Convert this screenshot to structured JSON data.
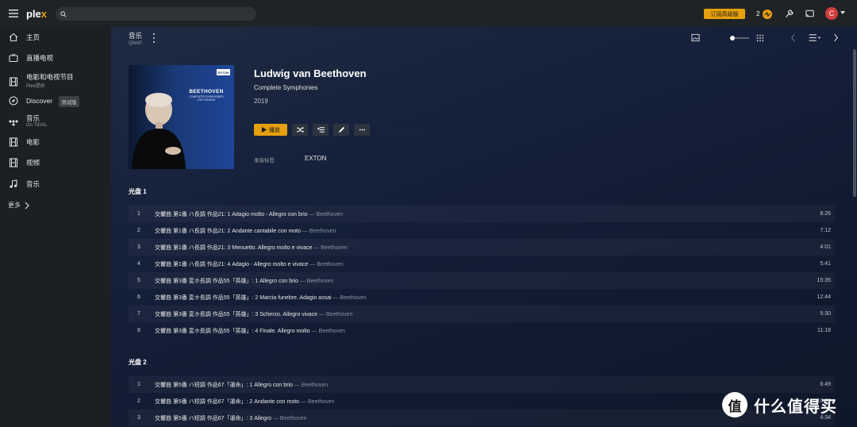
{
  "topbar": {
    "logo_main": "ple",
    "logo_x": "x",
    "search_placeholder": "",
    "subscribe_label": "订阅高级版",
    "activity_count": "2",
    "avatar_initial": "C"
  },
  "sidebar": {
    "items": [
      {
        "label": "主页",
        "sub": "",
        "icon": "home-icon"
      },
      {
        "label": "直播电视",
        "sub": "",
        "icon": "tv-icon"
      },
      {
        "label": "电影和电视节目",
        "sub": "Plex提供",
        "icon": "film-icon"
      },
      {
        "label": "Discover",
        "sub": "",
        "icon": "compass-icon"
      },
      {
        "label": "音乐",
        "sub": "On TIDAL",
        "icon": "tidal-icon"
      },
      {
        "label": "电影",
        "sub": "",
        "icon": "film-icon"
      },
      {
        "label": "视频",
        "sub": "",
        "icon": "film-icon"
      },
      {
        "label": "音乐",
        "sub": "",
        "icon": "music-note-icon"
      }
    ],
    "beta_badge": "测试版",
    "more_label": "更多"
  },
  "header": {
    "title": "音乐",
    "server": "QNAP"
  },
  "album": {
    "cover_title": "BEETHOVEN",
    "cover_sub1": "COMPLETE SYMPHONIES",
    "cover_sub2": "JOE HISAISHI",
    "cover_label": "EXTON",
    "artist": "Ludwig van Beethoven",
    "title": "Complete Symphonies",
    "year": "2019",
    "play_label": "播放",
    "record_label_key": "录音标签",
    "record_label_value": "EXTON",
    "dots": "· · · · · ·"
  },
  "discs": [
    {
      "label": "光盘 1",
      "tracks": [
        {
          "num": "1",
          "title": "交響曲 第1番 ハ長調 作品21: 1 Adagio molto - Allegro con brio",
          "artist": "— Beethoven",
          "duration": "8:26"
        },
        {
          "num": "2",
          "title": "交響曲 第1番 ハ長調 作品21: 2 Andante cantabile con moto",
          "artist": "— Beethoven",
          "duration": "7:12"
        },
        {
          "num": "3",
          "title": "交響曲 第1番 ハ長調 作品21: 3 Menuetto. Allegro molto e vivace",
          "artist": "— Beethoven",
          "duration": "4:01"
        },
        {
          "num": "4",
          "title": "交響曲 第1番 ハ長調 作品21: 4 Adagio - Allegro molto e vivace",
          "artist": "— Beethoven",
          "duration": "5:41"
        },
        {
          "num": "5",
          "title": "交響曲 第3番 変ホ長調 作品55「英雄」: 1 Allegro con brio",
          "artist": "— Beethoven",
          "duration": "15:35"
        },
        {
          "num": "6",
          "title": "交響曲 第3番 変ホ長調 作品55「英雄」: 2 Marcia funebre. Adagio assai",
          "artist": "— Beethoven",
          "duration": "12:44"
        },
        {
          "num": "7",
          "title": "交響曲 第3番 変ホ長調 作品55「英雄」: 3 Scherzo. Allegro vivace",
          "artist": "— Beethoven",
          "duration": "5:30"
        },
        {
          "num": "8",
          "title": "交響曲 第3番 変ホ長調 作品55「英雄」: 4 Finale. Allegro molto",
          "artist": "— Beethoven",
          "duration": "11:18"
        }
      ]
    },
    {
      "label": "光盘 2",
      "tracks": [
        {
          "num": "1",
          "title": "交響曲 第5番 ハ短調 作品67「運命」: 1 Allegro con brio",
          "artist": "— Beethoven",
          "duration": "6:49"
        },
        {
          "num": "2",
          "title": "交響曲 第5番 ハ短調 作品67「運命」: 2 Andante con moto",
          "artist": "— Beethoven",
          "duration": "10:09"
        },
        {
          "num": "3",
          "title": "交響曲 第5番 ハ短調 作品67「運命」: 3 Allegro",
          "artist": "— Beethoven",
          "duration": "4:34"
        }
      ]
    }
  ],
  "watermark": {
    "glyph": "值",
    "text": "什么值得买"
  },
  "colors": {
    "accent": "#e5a00d",
    "topbar": "#1f2326",
    "sidebar": "#1c1f24",
    "main_bg": "#15203a"
  }
}
